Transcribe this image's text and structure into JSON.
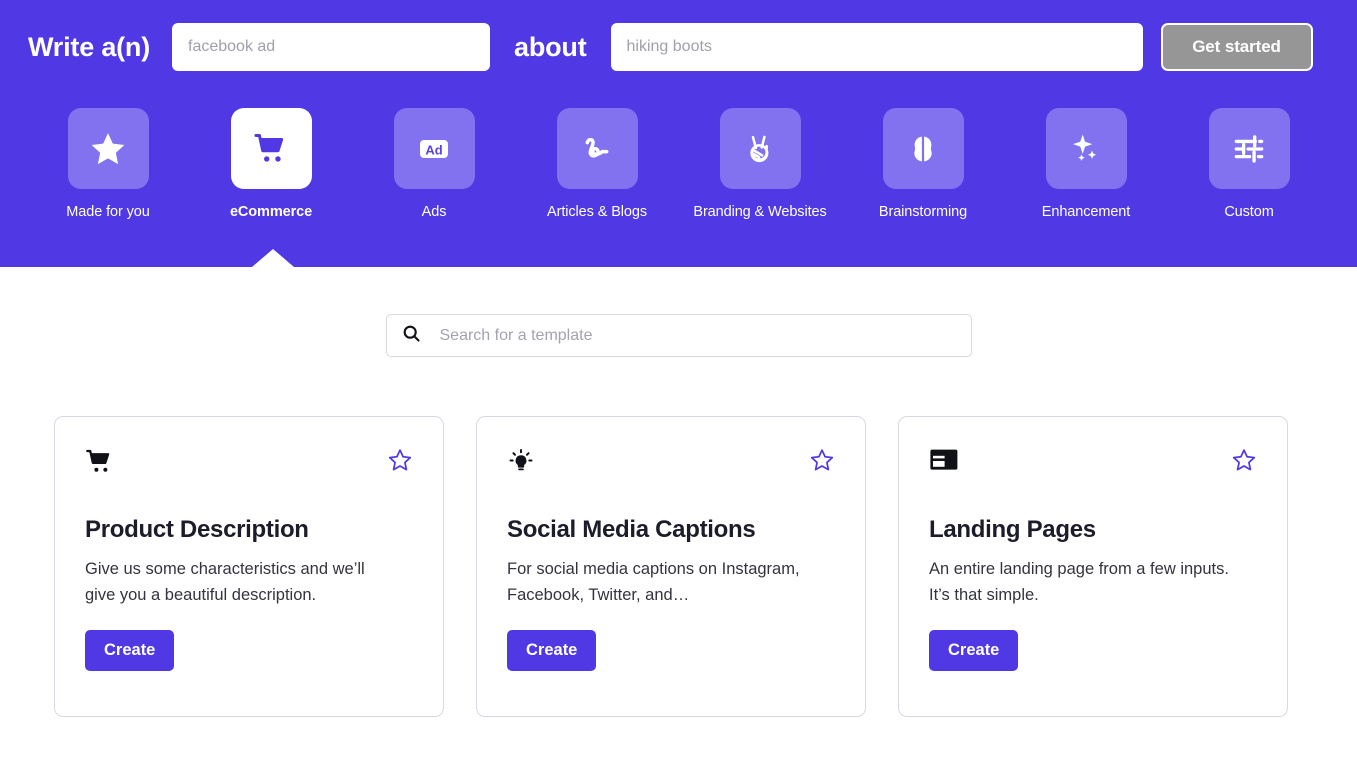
{
  "header": {
    "label_lead": "Write a(n)",
    "label_mid": "about",
    "type_input": {
      "value": "",
      "placeholder": "facebook ad"
    },
    "topic_input": {
      "value": "",
      "placeholder": "hiking boots"
    },
    "get_started_label": "Get started"
  },
  "categories": [
    {
      "label": "Made for you",
      "icon": "star-icon",
      "active": false
    },
    {
      "label": "eCommerce",
      "icon": "shopping-cart-icon",
      "active": true
    },
    {
      "label": "Ads",
      "icon": "ad-badge-icon",
      "active": false
    },
    {
      "label": "Articles & Blogs",
      "icon": "squiggle-icon",
      "active": false
    },
    {
      "label": "Branding & Websites",
      "icon": "peace-hand-icon",
      "active": false
    },
    {
      "label": "Brainstorming",
      "icon": "brain-icon",
      "active": false
    },
    {
      "label": "Enhancement",
      "icon": "sparkle-icon",
      "active": false
    },
    {
      "label": "Custom",
      "icon": "sliders-icon",
      "active": false
    }
  ],
  "search": {
    "icon": "search-icon",
    "value": "",
    "placeholder": "Search for a template"
  },
  "cards": [
    {
      "icon": "shopping-cart-icon",
      "fav_icon": "star-outline-icon",
      "title": "Product Description",
      "description": "Give us some characteristics and we’ll give you a beautiful description.",
      "button_label": "Create"
    },
    {
      "icon": "lightbulb-icon",
      "fav_icon": "star-outline-icon",
      "title": "Social Media Captions",
      "description": "For social media captions on Instagram, Facebook, Twitter, and…",
      "button_label": "Create"
    },
    {
      "icon": "layout-icon",
      "fav_icon": "star-outline-icon",
      "title": "Landing Pages",
      "description": "An entire landing page from a few inputs. It’s that simple.",
      "button_label": "Create"
    }
  ],
  "colors": {
    "brand_purple": "#5038E5",
    "tile_purple": "#8272F0",
    "get_started_gray": "#969696",
    "card_border": "#d8d8e2",
    "star_outline": "#5038E5"
  }
}
